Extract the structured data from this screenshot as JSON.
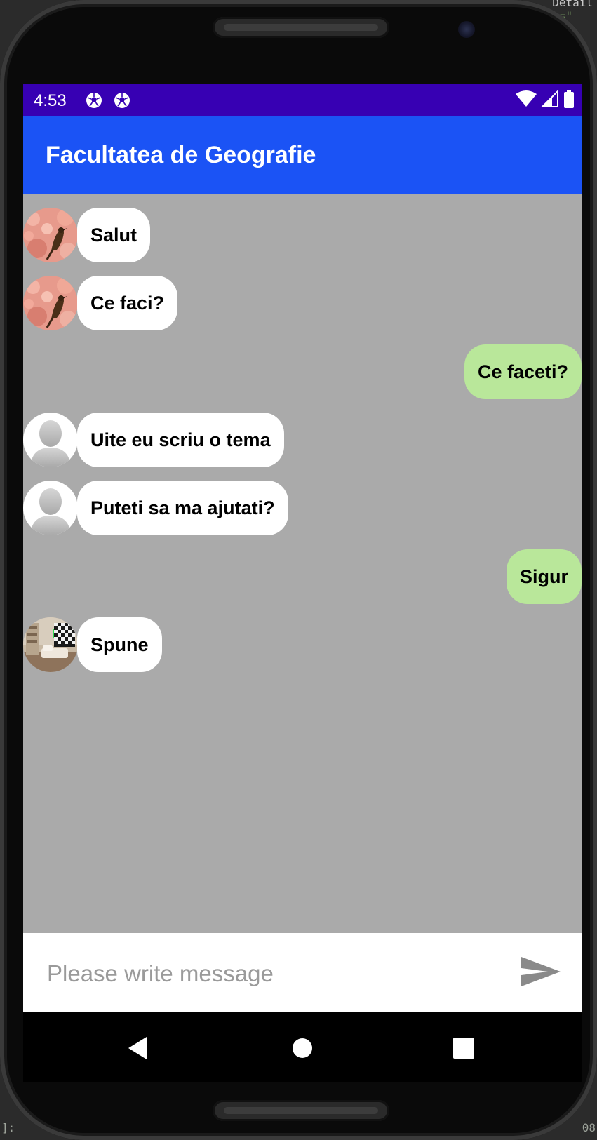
{
  "status_bar": {
    "time": "4:53",
    "notification_icons": [
      "soccer-ball-icon",
      "soccer-ball-icon"
    ],
    "system_icons": [
      "wifi-icon",
      "signal-icon",
      "battery-icon"
    ],
    "background_color": "#3700b3"
  },
  "app_bar": {
    "title": "Facultatea de Geografie",
    "background_color": "#1b53f5"
  },
  "chat": {
    "background_color": "#aaaaaa",
    "incoming_bubble_color": "#ffffff",
    "outgoing_bubble_color": "#b9e79a",
    "messages": [
      {
        "text": "Salut",
        "direction": "incoming",
        "avatar": "bird-blossom-avatar"
      },
      {
        "text": "Ce faci?",
        "direction": "incoming",
        "avatar": "bird-blossom-avatar"
      },
      {
        "text": "Ce faceti?",
        "direction": "outgoing"
      },
      {
        "text": "Uite eu scriu o tema",
        "direction": "incoming",
        "avatar": "default-person-avatar"
      },
      {
        "text": "Puteti sa ma ajutati?",
        "direction": "incoming",
        "avatar": "default-person-avatar"
      },
      {
        "text": "Sigur",
        "direction": "outgoing"
      },
      {
        "text": "Spune",
        "direction": "incoming",
        "avatar": "room-interior-avatar"
      }
    ]
  },
  "composer": {
    "placeholder": "Please write message",
    "value": "",
    "send_icon": "send-icon"
  },
  "navigation": {
    "buttons": [
      "back-icon",
      "home-icon",
      "recents-icon"
    ]
  },
  "desktop_background": {
    "top_right_text": "Detail",
    "top_right_text_2": "e=\"",
    "bottom_left_text": "]:",
    "bottom_right_text": "08"
  }
}
